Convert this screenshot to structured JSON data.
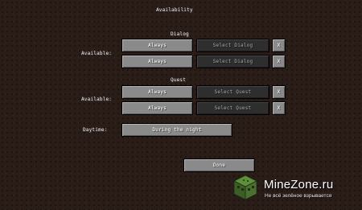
{
  "title": "Availability",
  "dialog": {
    "section_label": "Dialog",
    "row_label": "Available:",
    "rows": [
      {
        "mode": "Always",
        "select": "Select Dialog",
        "remove": "X"
      },
      {
        "mode": "Always",
        "select": "Select Dialog",
        "remove": "X"
      }
    ]
  },
  "quest": {
    "section_label": "Quest",
    "row_label": "Available:",
    "rows": [
      {
        "mode": "Always",
        "select": "Select Quest",
        "remove": "X"
      },
      {
        "mode": "Always",
        "select": "Select Quest",
        "remove": "X"
      }
    ]
  },
  "daytime": {
    "label": "Daytime:",
    "value": "During the night"
  },
  "done_label": "Done",
  "watermark": {
    "site": "MineZone.ru",
    "tagline": "Не всё зелёное взрывается"
  }
}
